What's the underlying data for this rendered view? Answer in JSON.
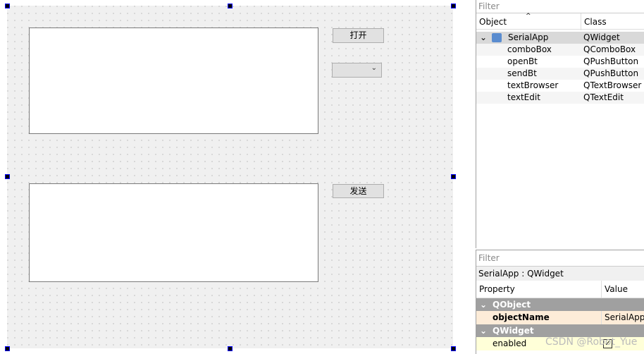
{
  "form": {
    "open_button": "打开",
    "send_button": "发送",
    "combo_value": ""
  },
  "object_inspector": {
    "filter_placeholder": "Filter",
    "columns": [
      "Object",
      "Class"
    ],
    "root": {
      "name": "SerialApp",
      "class": "QWidget"
    },
    "children": [
      {
        "name": "comboBox",
        "class": "QComboBox"
      },
      {
        "name": "openBt",
        "class": "QPushButton"
      },
      {
        "name": "sendBt",
        "class": "QPushButton"
      },
      {
        "name": "textBrowser",
        "class": "QTextBrowser"
      },
      {
        "name": "textEdit",
        "class": "QTextEdit"
      }
    ]
  },
  "property_editor": {
    "filter_placeholder": "Filter",
    "context": "SerialApp : QWidget",
    "columns": [
      "Property",
      "Value"
    ],
    "groups": [
      {
        "name": "QObject"
      },
      {
        "name": "QWidget"
      }
    ],
    "properties": [
      {
        "name": "objectName",
        "value": "SerialApp"
      },
      {
        "name": "enabled",
        "value": "checked"
      }
    ]
  },
  "watermark": "CSDN @Robot_Yue"
}
